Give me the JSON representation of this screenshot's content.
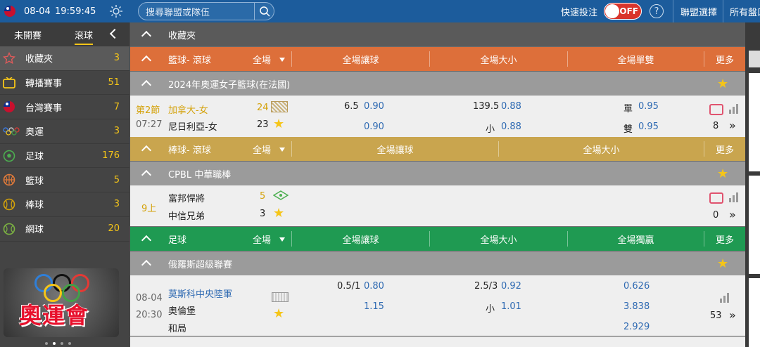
{
  "topbar": {
    "date": "08-04",
    "time": "19:59:45",
    "search_placeholder": "搜尋聯盟或隊伍",
    "quick_bet_label": "快速投注",
    "quick_bet_state": "OFF",
    "league_select": "聯盟選擇",
    "all_odds": "所有盤口"
  },
  "sidebar": {
    "tabs": [
      "未開賽",
      "滾球"
    ],
    "active_tab": "滾球",
    "items": [
      {
        "icon": "star-icon",
        "label": "收藏夾",
        "count": "3"
      },
      {
        "icon": "tv-icon",
        "label": "轉播賽事",
        "count": "51"
      },
      {
        "icon": "taiwan-flag-icon",
        "label": "台灣賽事",
        "count": "7"
      },
      {
        "icon": "olympic-rings-icon",
        "label": "奧運",
        "count": "3"
      },
      {
        "icon": "soccer-ball-icon",
        "label": "足球",
        "count": "176"
      },
      {
        "icon": "basketball-icon",
        "label": "籃球",
        "count": "5"
      },
      {
        "icon": "baseball-icon",
        "label": "棒球",
        "count": "3"
      },
      {
        "icon": "tennis-ball-icon",
        "label": "網球",
        "count": "20"
      }
    ],
    "banner_text": "奧運會"
  },
  "main": {
    "favorites_title": "收藏夾",
    "basketball": {
      "header": {
        "title": "籃球- 滾球",
        "filter": "全場",
        "col1": "全場讓球",
        "col2": "全場大小",
        "col3": "全場單雙",
        "more": "更多"
      },
      "league": "2024年奧運女子籃球(在法國)",
      "match": {
        "period": "第2節",
        "clock": "07:27",
        "home": "加拿大-女",
        "home_score": "24",
        "away": "尼日利亞-女",
        "away_score": "23",
        "hdp_line": "6.5",
        "hdp_home": "0.90",
        "hdp_away": "0.90",
        "ou_line": "139.5",
        "ou_over": "0.88",
        "ou_under_label": "小",
        "ou_under": "0.88",
        "odd_label": "單",
        "odd": "0.95",
        "even_label": "雙",
        "even": "0.95",
        "more_count": "8"
      }
    },
    "baseball": {
      "header": {
        "title": "棒球- 滾球",
        "filter": "全場",
        "col1": "全場讓球",
        "col2": "全場大小",
        "more": "更多"
      },
      "league": "CPBL 中華職棒",
      "match": {
        "inning": "9上",
        "home": "富邦悍將",
        "home_score": "5",
        "away": "中信兄弟",
        "away_score": "3",
        "more_count": "0"
      }
    },
    "soccer": {
      "header": {
        "title": "足球",
        "filter": "全場",
        "col1": "全場讓球",
        "col2": "全場大小",
        "col3": "全場獨贏",
        "more": "更多"
      },
      "league": "俄羅斯超級聯賽",
      "match": {
        "date": "08-04",
        "time": "20:30",
        "home": "莫斯科中央陸軍",
        "away": "奧倫堡",
        "draw": "和局",
        "hdp_line": "0.5/1",
        "hdp_home": "0.80",
        "hdp_away": "1.15",
        "ou_line": "2.5/3",
        "ou_over": "0.92",
        "ou_under_label": "小",
        "ou_under": "1.01",
        "x1": "0.626",
        "x2": "3.838",
        "xx": "2.929",
        "more_count": "53"
      }
    }
  },
  "colors": {
    "topbar": "#1c5c9c",
    "basketball": "#dd6f3a",
    "baseball": "#c9a54e",
    "soccer": "#1f9a52",
    "accent": "#f5c518"
  }
}
